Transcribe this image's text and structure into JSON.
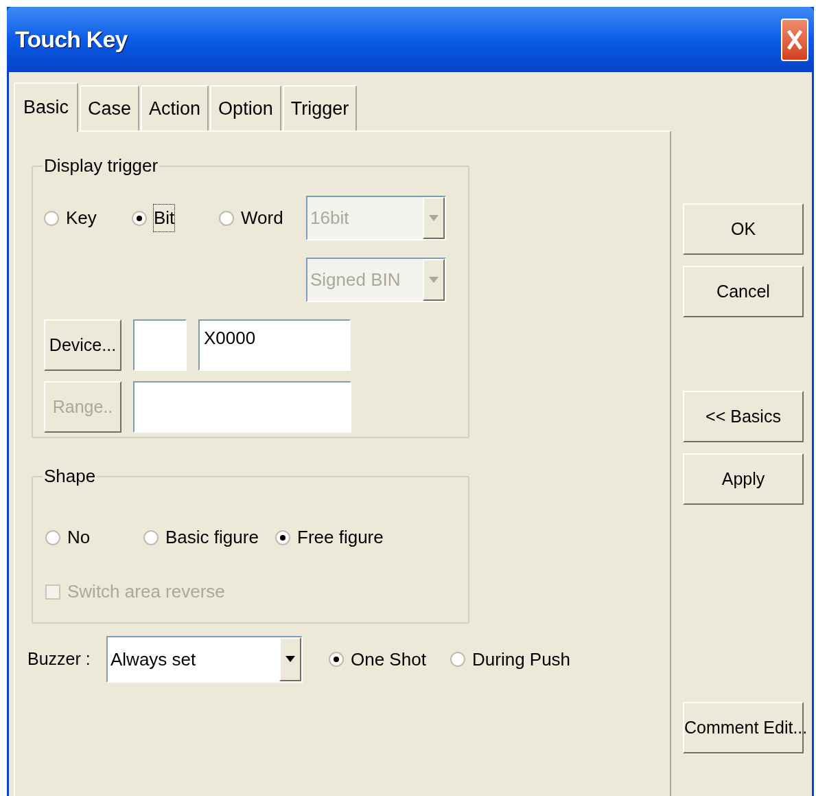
{
  "window": {
    "title": "Touch Key"
  },
  "tabs": [
    {
      "label": "Basic",
      "selected": true
    },
    {
      "label": "Case",
      "selected": false
    },
    {
      "label": "Action",
      "selected": false
    },
    {
      "label": "Option",
      "selected": false
    },
    {
      "label": "Trigger",
      "selected": false
    }
  ],
  "display_trigger": {
    "title": "Display trigger",
    "options": [
      {
        "label": "Key",
        "selected": false,
        "focused": false
      },
      {
        "label": "Bit",
        "selected": true,
        "focused": true
      },
      {
        "label": "Word",
        "selected": false,
        "focused": false
      }
    ],
    "data_length": {
      "value": "16bit",
      "disabled": true
    },
    "data_format": {
      "value": "Signed BIN",
      "disabled": true
    },
    "device_button": {
      "label": "Device...",
      "disabled": false
    },
    "device_value": "X0000",
    "range_button": {
      "label": "Range..",
      "disabled": true
    }
  },
  "shape": {
    "title": "Shape",
    "options": [
      {
        "label": "No",
        "selected": false
      },
      {
        "label": "Basic figure",
        "selected": false
      },
      {
        "label": "Free figure",
        "selected": true
      }
    ],
    "switch_area_reverse": {
      "label": "Switch area reverse",
      "checked": false,
      "disabled": true
    }
  },
  "buzzer": {
    "label": "Buzzer :",
    "value": "Always set",
    "modes": [
      {
        "label": "One Shot",
        "selected": true
      },
      {
        "label": "During Push",
        "selected": false
      }
    ]
  },
  "buttons": [
    {
      "label": "OK",
      "disabled": false
    },
    {
      "label": "Cancel",
      "disabled": false
    },
    {
      "label": "<< Basics",
      "disabled": false
    },
    {
      "label": "Apply",
      "disabled": false
    },
    {
      "label": "Comment Edit...",
      "disabled": false
    }
  ]
}
